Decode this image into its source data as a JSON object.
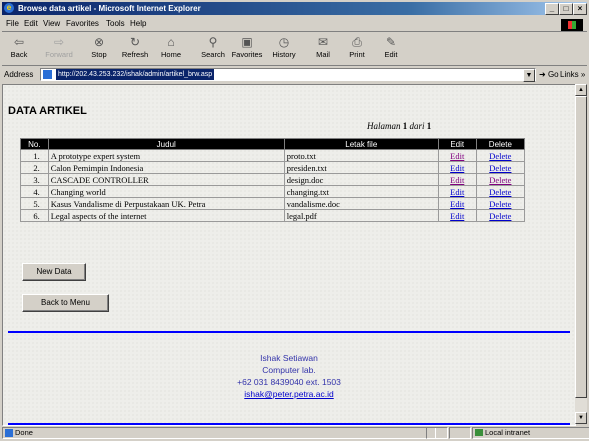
{
  "window": {
    "title": "Browse data artikel - Microsoft Internet Explorer",
    "controls": [
      "_",
      "□",
      "×"
    ]
  },
  "menu": [
    "File",
    "Edit",
    "View",
    "Favorites",
    "Tools",
    "Help"
  ],
  "toolbar": {
    "back": "Back",
    "forward": "Forward",
    "stop": "Stop",
    "refresh": "Refresh",
    "home": "Home",
    "search": "Search",
    "favorites": "Favorites",
    "history": "History",
    "mail": "Mail",
    "print": "Print",
    "edit": "Edit"
  },
  "address": {
    "label": "Address",
    "url": "http://202.43.253.232/ishak/admin/artikel_brw.asp",
    "go": "Go",
    "links": "Links"
  },
  "page": {
    "heading": "DATA ARTIKEL",
    "pager_prefix": "Halaman",
    "pager_current": "1",
    "pager_mid": "dari",
    "pager_total": "1"
  },
  "table": {
    "headers": [
      "No.",
      "Judul",
      "Letak file",
      "Edit",
      "Delete"
    ],
    "rows": [
      {
        "no": "1.",
        "judul": "A prototype expert system",
        "file": "proto.txt",
        "edit": "Edit",
        "delete": "Delete"
      },
      {
        "no": "2.",
        "judul": "Calon Pemimpin Indonesia",
        "file": "presiden.txt",
        "edit": "Edit",
        "delete": "Delete"
      },
      {
        "no": "3.",
        "judul": "CASCADE CONTROLLER",
        "file": "design.doc",
        "edit": "Edit",
        "delete": "Delete"
      },
      {
        "no": "4.",
        "judul": "Changing world",
        "file": "changing.txt",
        "edit": "Edit",
        "delete": "Delete"
      },
      {
        "no": "5.",
        "judul": "Kasus Vandalisme di Perpustakaan UK. Petra",
        "file": "vandalisme.doc",
        "edit": "Edit",
        "delete": "Delete"
      },
      {
        "no": "6.",
        "judul": "Legal aspects of the internet",
        "file": "legal.pdf",
        "edit": "Edit",
        "delete": "Delete"
      }
    ]
  },
  "buttons": {
    "new_data": "New Data",
    "back_to_menu": "Back to Menu"
  },
  "footer": {
    "name": "Ishak Setiawan",
    "dept": "Computer lab.",
    "phone": "+62 031 8439040 ext. 1503",
    "email": "ishak@peter.petra.ac.id"
  },
  "status": {
    "text": "Done",
    "zone": "Local intranet"
  },
  "colors": {
    "accent_line": "#0000ff",
    "link_visited": "#800080",
    "link": "#0000cc"
  }
}
